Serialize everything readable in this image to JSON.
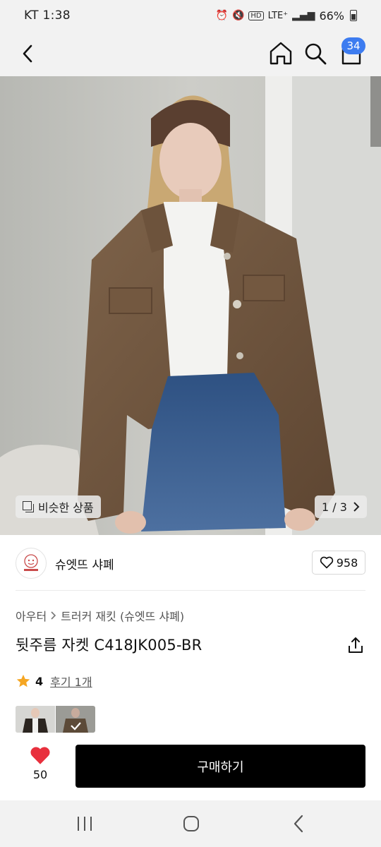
{
  "status_bar": {
    "carrier_time": "KT 1:38",
    "network": "LTE⁺",
    "battery": "66%",
    "icons": [
      "alarm-icon",
      "mute-icon",
      "hd-icon",
      "signal-icon",
      "battery-icon"
    ]
  },
  "header": {
    "icons": [
      "back-icon",
      "home-icon",
      "search-icon",
      "cart-icon"
    ],
    "cart_count": "34"
  },
  "hero": {
    "similar_label": "비슷한 상품",
    "pager": "1 / 3",
    "current_image": 1,
    "total_images": 3
  },
  "brand": {
    "name": "슈엣뜨 샤폐",
    "likes": "958"
  },
  "product": {
    "breadcrumb_category": "아우터",
    "breadcrumb_sub": "트러커 재킷 (슈엣뜨 샤폐)",
    "title": "뒷주름 자켓 C418JK005-BR",
    "rating": "4",
    "review_label": "후기 1개"
  },
  "bottom_bar": {
    "wish_count": "50",
    "buy_label": "구매하기"
  },
  "colors": {
    "accent_badge": "#3d7cf0",
    "heart": "#e8303d",
    "star": "#f5a623",
    "buy_bg": "#000000"
  }
}
